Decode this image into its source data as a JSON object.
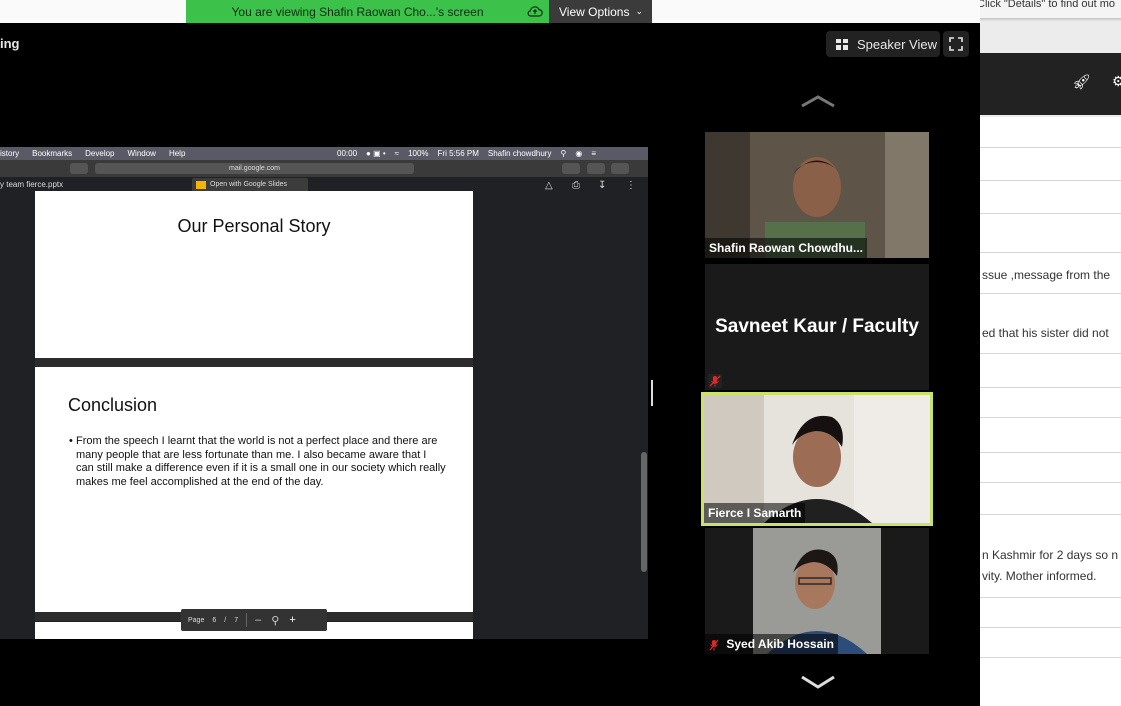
{
  "banner": {
    "viewing_text": "You are viewing Shafin Raowan Cho...'s screen",
    "view_options_label": "View Options"
  },
  "zoom": {
    "meeting_title_fragment": "ing",
    "speaker_view_label": "Speaker View"
  },
  "shared_screen": {
    "menubar": {
      "items": [
        "istory",
        "Bookmarks",
        "Develop",
        "Window",
        "Help"
      ],
      "right_items": [
        "00:00",
        "100%",
        "Fri 5:56 PM",
        "Shafin chowdhury"
      ]
    },
    "url": "mail.google.com",
    "file_name": "y team fierce.pptx",
    "open_with_label": "Open with Google Slides",
    "slides": [
      {
        "title": "Our Personal Story"
      },
      {
        "title": "Conclusion",
        "body": "From the speech I learnt that the world is not a perfect place and there are many people that are less fortunate than me. I also became aware that I can still make a difference even if it is a small one in our society which really makes me feel accomplished at the end of the day."
      }
    ],
    "page_control": {
      "page_label": "Page",
      "current_page": "6",
      "separator": "/",
      "total_pages": "7",
      "zoom_out": "–",
      "zoom_in": "+"
    }
  },
  "participants": [
    {
      "name": "Shafin Raowan Chowdhu...",
      "muted": false
    },
    {
      "name": "Savneet Kaur / Faculty",
      "muted": true
    },
    {
      "name": "Fierce I Samarth",
      "muted": false,
      "active_speaker": true
    },
    {
      "name": "Syed Akib Hossain",
      "muted": true
    }
  ],
  "background_window": {
    "notification": "Click \"Details\" to find out mo",
    "snippets": [
      "ssue ,message from the",
      "ed that his sister did not",
      "n Kashmir for 2 days so n",
      "vity. Mother informed."
    ]
  },
  "colors": {
    "banner_green": "#3cc24a",
    "active_speaker_border": "#c9e26a",
    "muted_icon": "#e02828"
  }
}
